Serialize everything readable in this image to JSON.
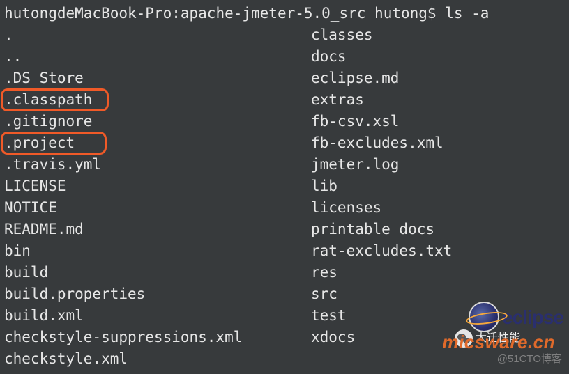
{
  "prompt": {
    "host": "hutongdeMacBook-Pro",
    "sep1": ":",
    "dir": "apache-jmeter-5.0_src",
    "user": "hutong",
    "sym": "$",
    "cmd": "ls -a"
  },
  "listing": {
    "col1": [
      ".",
      "..",
      ".DS_Store",
      ".classpath",
      ".gitignore",
      ".project",
      ".travis.yml",
      "LICENSE",
      "NOTICE",
      "README.md",
      "bin",
      "build",
      "build.properties",
      "build.xml",
      "checkstyle-suppressions.xml",
      "checkstyle.xml"
    ],
    "col2": [
      "classes",
      "docs",
      "eclipse.md",
      "extras",
      "fb-csv.xsl",
      "fb-excludes.xml",
      "jmeter.log",
      "lib",
      "licenses",
      "printable_docs",
      "rat-excludes.txt",
      "res",
      "src",
      "test",
      "xdocs"
    ]
  },
  "highlights": [
    ".classpath",
    ".project"
  ],
  "watermarks": {
    "eclipse": "eclipse",
    "micsware": "micsware.cn",
    "wechat_label": "大迁性能",
    "cto": "@51CTO博客"
  }
}
